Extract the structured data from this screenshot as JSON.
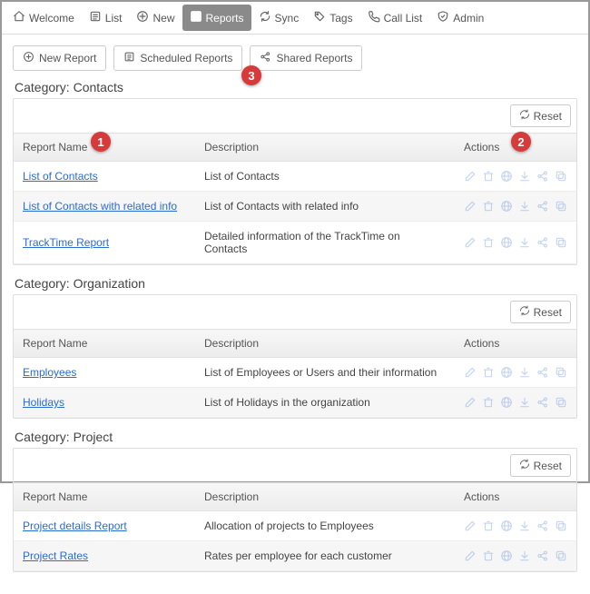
{
  "nav": {
    "items": [
      {
        "label": "Welcome",
        "icon": "home"
      },
      {
        "label": "List",
        "icon": "list"
      },
      {
        "label": "New",
        "icon": "plus"
      },
      {
        "label": "Reports",
        "icon": "chart",
        "active": true
      },
      {
        "label": "Sync",
        "icon": "sync"
      },
      {
        "label": "Tags",
        "icon": "tag"
      },
      {
        "label": "Call List",
        "icon": "phone"
      },
      {
        "label": "Admin",
        "icon": "shield"
      }
    ]
  },
  "toolbar": {
    "new_report": "New Report",
    "scheduled_reports": "Scheduled Reports",
    "shared_reports": "Shared Reports"
  },
  "headers": {
    "name": "Report Name",
    "desc": "Description",
    "actions": "Actions",
    "reset": "Reset"
  },
  "callouts": {
    "c1": "1",
    "c2": "2",
    "c3": "3"
  },
  "categories": [
    {
      "title": "Category: Contacts",
      "rows": [
        {
          "name": "List of Contacts",
          "desc": "List of Contacts"
        },
        {
          "name": "List of Contacts with related info",
          "desc": "List of Contacts with related info"
        },
        {
          "name": "TrackTime Report",
          "desc": "Detailed information of the TrackTime on Contacts"
        }
      ]
    },
    {
      "title": "Category: Organization",
      "rows": [
        {
          "name": "Employees",
          "desc": "List of Employees or Users and their information"
        },
        {
          "name": "Holidays",
          "desc": "List of Holidays in the organization"
        }
      ]
    },
    {
      "title": "Category: Project",
      "rows": [
        {
          "name": "Project details Report",
          "desc": "Allocation of projects to Employees"
        },
        {
          "name": "Project Rates",
          "desc": "Rates per employee for each customer"
        }
      ]
    }
  ],
  "icons": {
    "actions": [
      "edit",
      "delete",
      "globe",
      "download",
      "share",
      "copy"
    ]
  }
}
